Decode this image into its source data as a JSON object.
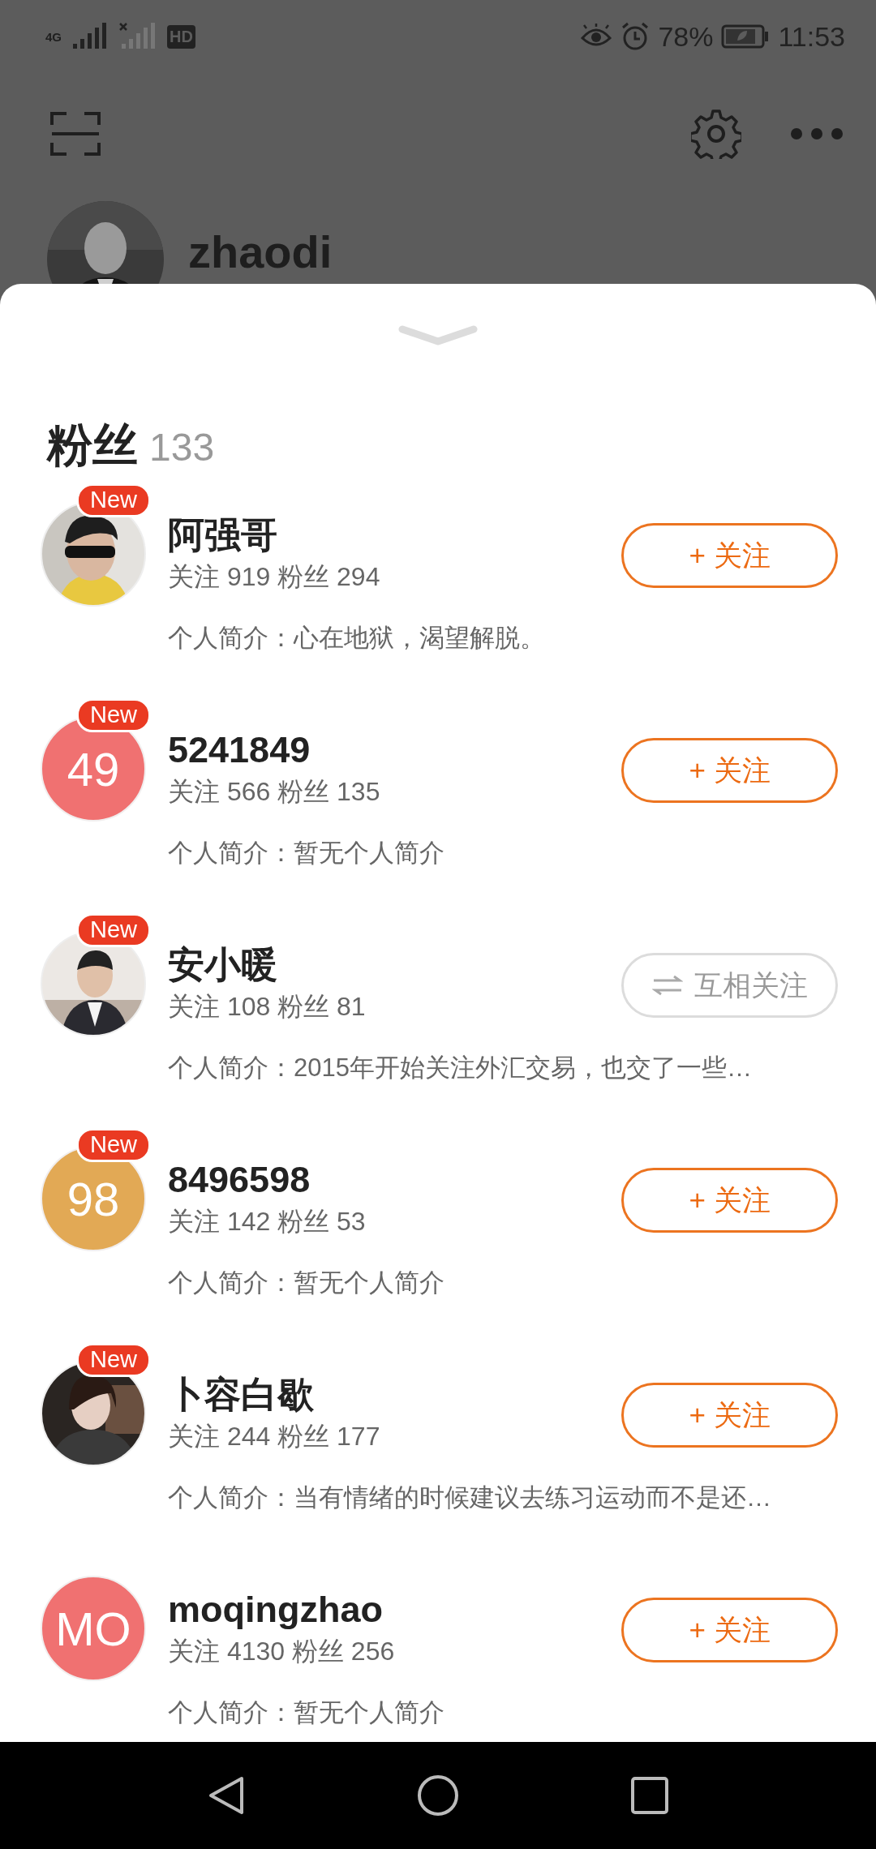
{
  "status_bar": {
    "network": "4G",
    "hd": "HD",
    "battery": "78%",
    "time": "11:53"
  },
  "profile": {
    "username": "zhaodi"
  },
  "followers": {
    "title": "粉丝",
    "count": "133",
    "items": [
      {
        "name": "阿强哥",
        "stats": "关注 919 粉丝 294",
        "bio": "个人简介：心在地狱，渴望解脱。",
        "badge": "New",
        "button": {
          "kind": "follow",
          "label": "+ 关注"
        }
      },
      {
        "name": "5241849",
        "stats": "关注 566 粉丝 135",
        "bio": "个人简介：暂无个人简介",
        "badge": "New",
        "avatar": {
          "kind": "initials",
          "text": "49",
          "color": "#f07171"
        },
        "button": {
          "kind": "follow",
          "label": "+ 关注"
        }
      },
      {
        "name": "安小暖",
        "stats": "关注 108 粉丝 81",
        "bio": "个人简介：2015年开始关注外汇交易，也交了一些…",
        "badge": "New",
        "button": {
          "kind": "mutual",
          "label": "互相关注"
        }
      },
      {
        "name": "8496598",
        "stats": "关注 142 粉丝 53",
        "bio": "个人简介：暂无个人简介",
        "badge": "New",
        "avatar": {
          "kind": "initials",
          "text": "98",
          "color": "#e2a955"
        },
        "button": {
          "kind": "follow",
          "label": "+ 关注"
        }
      },
      {
        "name": "卜容白歇",
        "stats": "关注 244 粉丝 177",
        "bio": "个人简介：当有情绪的时候建议去练习运动而不是还…",
        "badge": "New",
        "button": {
          "kind": "follow",
          "label": "+ 关注"
        }
      },
      {
        "name": "moqingzhao",
        "stats": "关注 4130 粉丝 256",
        "bio": "个人简介：暂无个人简介",
        "avatar": {
          "kind": "initials",
          "text": "MO",
          "color": "#f07171"
        },
        "button": {
          "kind": "follow",
          "label": "+ 关注"
        }
      }
    ]
  }
}
